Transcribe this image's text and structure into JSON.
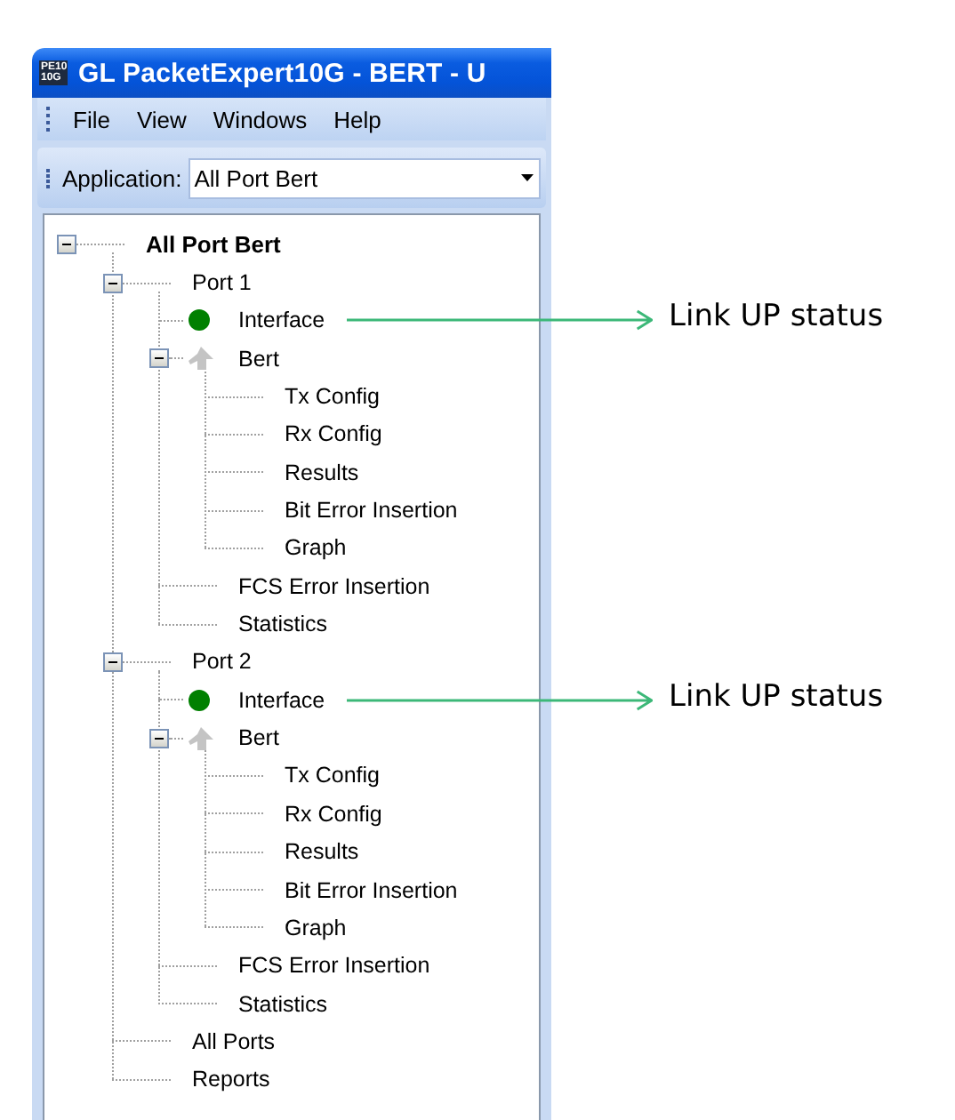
{
  "window": {
    "logo_text": [
      "PE10",
      "10G"
    ],
    "title": "GL PacketExpert10G - BERT - U"
  },
  "menu": [
    "File",
    "View",
    "Windows",
    "Help"
  ],
  "toolbar": {
    "label": "Application:",
    "dropdown": {
      "value": "All Port Bert"
    }
  },
  "tree": [
    {
      "label": "All Port Bert",
      "expanded": true,
      "children": [
        {
          "label": "Port 1",
          "expanded": true,
          "children": [
            {
              "label": "Interface",
              "kind": "status",
              "color": "#008000",
              "annotation": "Link UP status"
            },
            {
              "label": "Bert",
              "kind": "test",
              "expanded": true,
              "children": [
                {
                  "label": "Tx Config"
                },
                {
                  "label": "Rx Config"
                },
                {
                  "label": "Results"
                },
                {
                  "label": "Bit Error Insertion"
                },
                {
                  "label": "Graph"
                }
              ]
            },
            {
              "label": "FCS Error Insertion"
            },
            {
              "label": "Statistics"
            }
          ]
        },
        {
          "label": "Port 2",
          "expanded": true,
          "children": [
            {
              "label": "Interface",
              "kind": "status",
              "color": "#008000",
              "annotation": "Link UP status"
            },
            {
              "label": "Bert",
              "kind": "test",
              "expanded": true,
              "children": [
                {
                  "label": "Tx Config"
                },
                {
                  "label": "Rx Config"
                },
                {
                  "label": "Results"
                },
                {
                  "label": "Bit Error Insertion"
                },
                {
                  "label": "Graph"
                }
              ]
            },
            {
              "label": "FCS Error Insertion"
            },
            {
              "label": "Statistics"
            }
          ]
        },
        {
          "label": "All Ports"
        },
        {
          "label": "Reports"
        }
      ]
    }
  ]
}
